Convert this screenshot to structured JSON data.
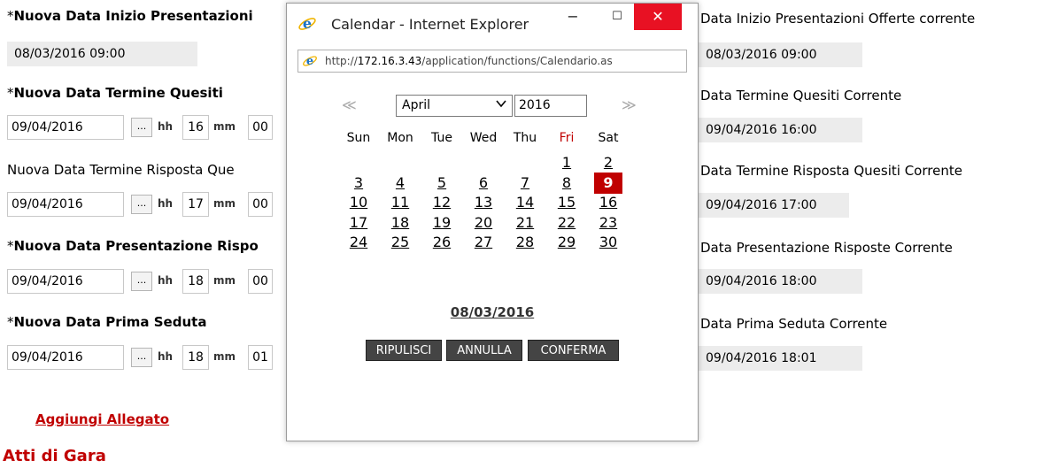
{
  "form": {
    "label1_star": "*",
    "label1": "Nuova Data Inizio Presentazioni",
    "value1": "08/03/2016 09:00",
    "label2_star": "*",
    "label2": "Nuova Data Termine Quesiti",
    "label3": "Nuova Data Termine Risposta Que",
    "label4_star": "*",
    "label4": "Nuova Data Presentazione Rispo",
    "label5_star": "*",
    "label5": "Nuova Data Prima Seduta",
    "rows": [
      {
        "date": "09/04/2016",
        "hh": "16",
        "mm": "00"
      },
      {
        "date": "09/04/2016",
        "hh": "17",
        "mm": "00"
      },
      {
        "date": "09/04/2016",
        "hh": "18",
        "mm": "00"
      },
      {
        "date": "09/04/2016",
        "hh": "18",
        "mm": "01"
      }
    ],
    "dots": "...",
    "hh_label": "hh",
    "mm_label": "mm",
    "add_attachment": "Aggiungi Allegato",
    "section_title": "Atti di Gara"
  },
  "current": {
    "label1": "Data Inizio Presentazioni Offerte corrente",
    "value1": "08/03/2016 09:00",
    "label2": "Data Termine Quesiti Corrente",
    "value2": "09/04/2016 16:00",
    "label3": "Data Termine Risposta Quesiti Corrente",
    "value3": "09/04/2016 17:00",
    "label4": "Data Presentazione Risposte Corrente",
    "value4": "09/04/2016 18:00",
    "label5": "Data Prima Seduta Corrente",
    "value5": "09/04/2016 18:01"
  },
  "popup": {
    "title": "Calendar - Internet Explorer",
    "minimize": "−",
    "maximize": "☐",
    "close": "✕",
    "url_host": "172.16.3.43",
    "url_prefix": "http://",
    "url_suffix": "/application/functions/Calendario.as",
    "prev": "≪",
    "next": "≫",
    "month": "April",
    "year": "2016",
    "weekdays": [
      "Sun",
      "Mon",
      "Tue",
      "Wed",
      "Thu",
      "Fri",
      "Sat"
    ],
    "weekday_highlight_color": "#c00000",
    "days": [
      [
        "",
        "",
        "",
        "",
        "",
        "1",
        "2"
      ],
      [
        "3",
        "4",
        "5",
        "6",
        "7",
        "8",
        "9"
      ],
      [
        "10",
        "11",
        "12",
        "13",
        "14",
        "15",
        "16"
      ],
      [
        "17",
        "18",
        "19",
        "20",
        "21",
        "22",
        "23"
      ],
      [
        "24",
        "25",
        "26",
        "27",
        "28",
        "29",
        "30"
      ]
    ],
    "selected_day": "9",
    "current_date": "08/03/2016",
    "btn_clear": "RIPULISCI",
    "btn_cancel": "ANNULLA",
    "btn_confirm": "CONFERMA"
  }
}
